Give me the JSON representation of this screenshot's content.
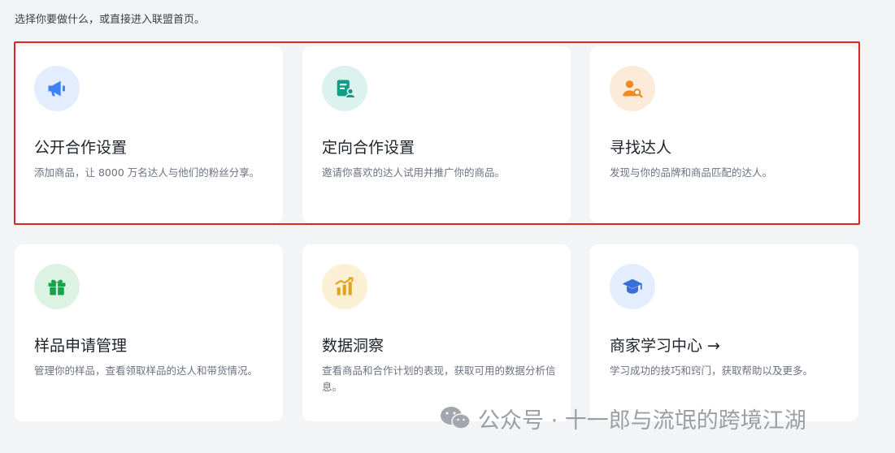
{
  "intro_text": "选择你要做什么，或直接进入联盟首页。",
  "cards": [
    {
      "title": "公开合作设置",
      "desc": "添加商品，让 8000 万名达人与他们的粉丝分享。",
      "icon": "megaphone-icon",
      "icon_color": "#3b82f6",
      "icon_bg": "#e4edfd"
    },
    {
      "title": "定向合作设置",
      "desc": "邀请你喜欢的达人试用并推广你的商品。",
      "icon": "document-user-icon",
      "icon_color": "#0f9d8a",
      "icon_bg": "#dcf2ee"
    },
    {
      "title": "寻找达人",
      "desc": "发现与你的品牌和商品匹配的达人。",
      "icon": "user-search-icon",
      "icon_color": "#f08a24",
      "icon_bg": "#fdebd9"
    },
    {
      "title": "样品申请管理",
      "desc": "管理你的样品，查看领取样品的达人和带货情况。",
      "icon": "gift-icon",
      "icon_color": "#16a34a",
      "icon_bg": "#dcf3e4"
    },
    {
      "title": "数据洞察",
      "desc": "查看商品和合作计划的表现，获取可用的数据分析信息。",
      "icon": "bar-chart-icon",
      "icon_color": "#e0a21a",
      "icon_bg": "#fcf0d4"
    },
    {
      "title": "商家学习中心 →",
      "desc": "学习成功的技巧和窍门，获取帮助以及更多。",
      "icon": "graduation-cap-icon",
      "icon_color": "#3b6fd8",
      "icon_bg": "#e4edfd"
    }
  ],
  "watermark": {
    "text": "公众号 · 十一郎与流氓的跨境江湖",
    "icon": "wechat-icon"
  },
  "highlight_color": "#e02424"
}
